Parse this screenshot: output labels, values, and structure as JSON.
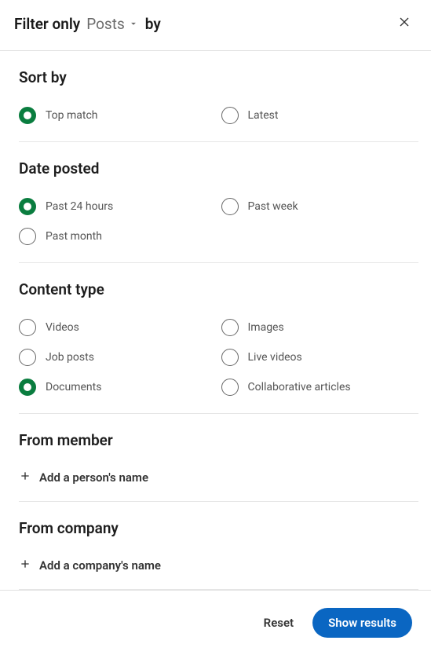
{
  "header": {
    "prefix": "Filter only",
    "dropdown_label": "Posts",
    "suffix": "by"
  },
  "sections": {
    "sort_by": {
      "title": "Sort by",
      "options": [
        {
          "label": "Top match",
          "selected": true
        },
        {
          "label": "Latest",
          "selected": false
        }
      ]
    },
    "date_posted": {
      "title": "Date posted",
      "options": [
        {
          "label": "Past 24 hours",
          "selected": true
        },
        {
          "label": "Past week",
          "selected": false
        },
        {
          "label": "Past month",
          "selected": false
        }
      ]
    },
    "content_type": {
      "title": "Content type",
      "options": [
        {
          "label": "Videos",
          "selected": false
        },
        {
          "label": "Images",
          "selected": false
        },
        {
          "label": "Job posts",
          "selected": false
        },
        {
          "label": "Live videos",
          "selected": false
        },
        {
          "label": "Documents",
          "selected": true
        },
        {
          "label": "Collaborative articles",
          "selected": false
        }
      ]
    },
    "from_member": {
      "title": "From member",
      "add_label": "Add a person's name"
    },
    "from_company": {
      "title": "From company",
      "add_label": "Add a company's name"
    }
  },
  "footer": {
    "reset_label": "Reset",
    "show_label": "Show results"
  }
}
